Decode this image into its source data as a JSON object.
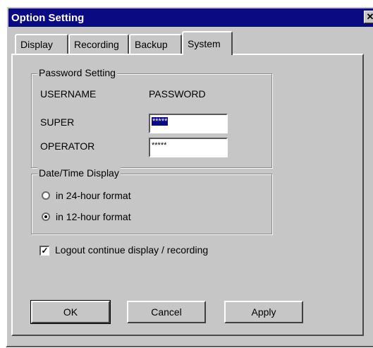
{
  "window": {
    "title": "Option Setting",
    "close_symbol": "✕"
  },
  "tabs": [
    {
      "label": "Display",
      "active": false
    },
    {
      "label": "Recording",
      "active": false
    },
    {
      "label": "Backup",
      "active": false
    },
    {
      "label": "System",
      "active": true
    }
  ],
  "password_group": {
    "title": "Password Setting",
    "col_username": "USERNAME",
    "col_password": "PASSWORD",
    "rows": [
      {
        "user": "SUPER",
        "value": "*****",
        "selected": true
      },
      {
        "user": "OPERATOR",
        "value": "*****",
        "selected": false
      }
    ]
  },
  "datetime_group": {
    "title": "Date/Time Display",
    "options": [
      {
        "label": "in 24-hour format",
        "checked": false
      },
      {
        "label": "in 12-hour format",
        "checked": true
      }
    ]
  },
  "logout_option": {
    "label": "Logout continue display / recording",
    "checked": true
  },
  "buttons": {
    "ok": "OK",
    "cancel": "Cancel",
    "apply": "Apply"
  },
  "colors": {
    "title_bar": "#0a0a82",
    "face": "#c6c6c6"
  }
}
